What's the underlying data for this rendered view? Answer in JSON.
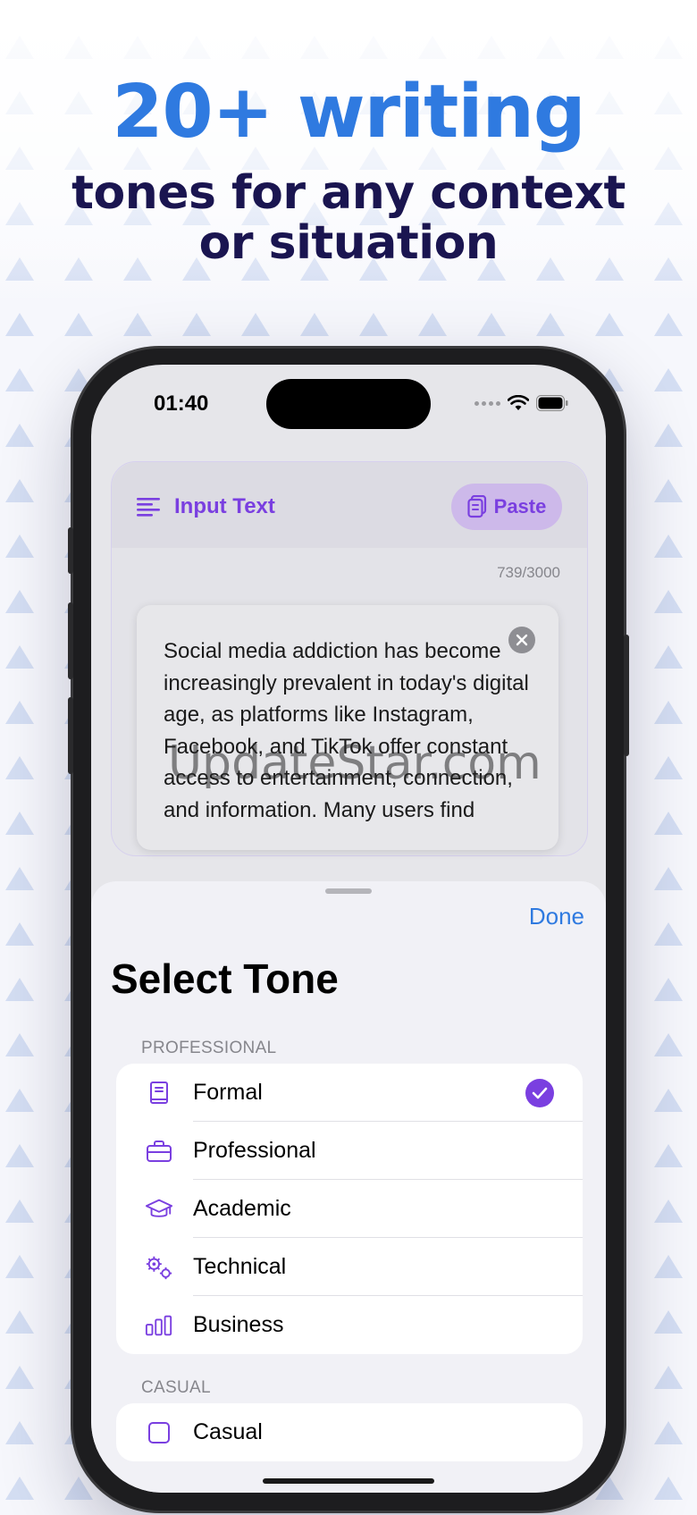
{
  "headline": {
    "line1": "20+ writing",
    "line2": "tones for any context",
    "line3": "or situation"
  },
  "status_bar": {
    "time": "01:40",
    "icons": [
      "cellular-dots-icon",
      "wifi-icon",
      "battery-icon"
    ]
  },
  "input_card": {
    "title": "Input Text",
    "paste_label": "Paste",
    "counter": "739/3000",
    "text": "Social media addiction has become increasingly prevalent in today's digital age, as platforms like Instagram, Facebook, and TikTok offer constant access to entertainment, connection, and information. Many users find"
  },
  "watermark": "UpdateStar.com",
  "sheet": {
    "done_label": "Done",
    "title": "Select Tone",
    "sections": [
      {
        "label": "PROFESSIONAL",
        "items": [
          {
            "label": "Formal",
            "icon": "book-icon",
            "selected": true
          },
          {
            "label": "Professional",
            "icon": "briefcase-icon",
            "selected": false
          },
          {
            "label": "Academic",
            "icon": "graduation-cap-icon",
            "selected": false
          },
          {
            "label": "Technical",
            "icon": "gears-icon",
            "selected": false
          },
          {
            "label": "Business",
            "icon": "bar-chart-icon",
            "selected": false
          }
        ]
      },
      {
        "label": "CASUAL",
        "items": [
          {
            "label": "Casual",
            "icon": "square-icon",
            "selected": false
          }
        ]
      }
    ]
  },
  "colors": {
    "accent_purple": "#7a3fe0",
    "accent_blue": "#2f7ae0",
    "headline_dark": "#1a1550"
  }
}
